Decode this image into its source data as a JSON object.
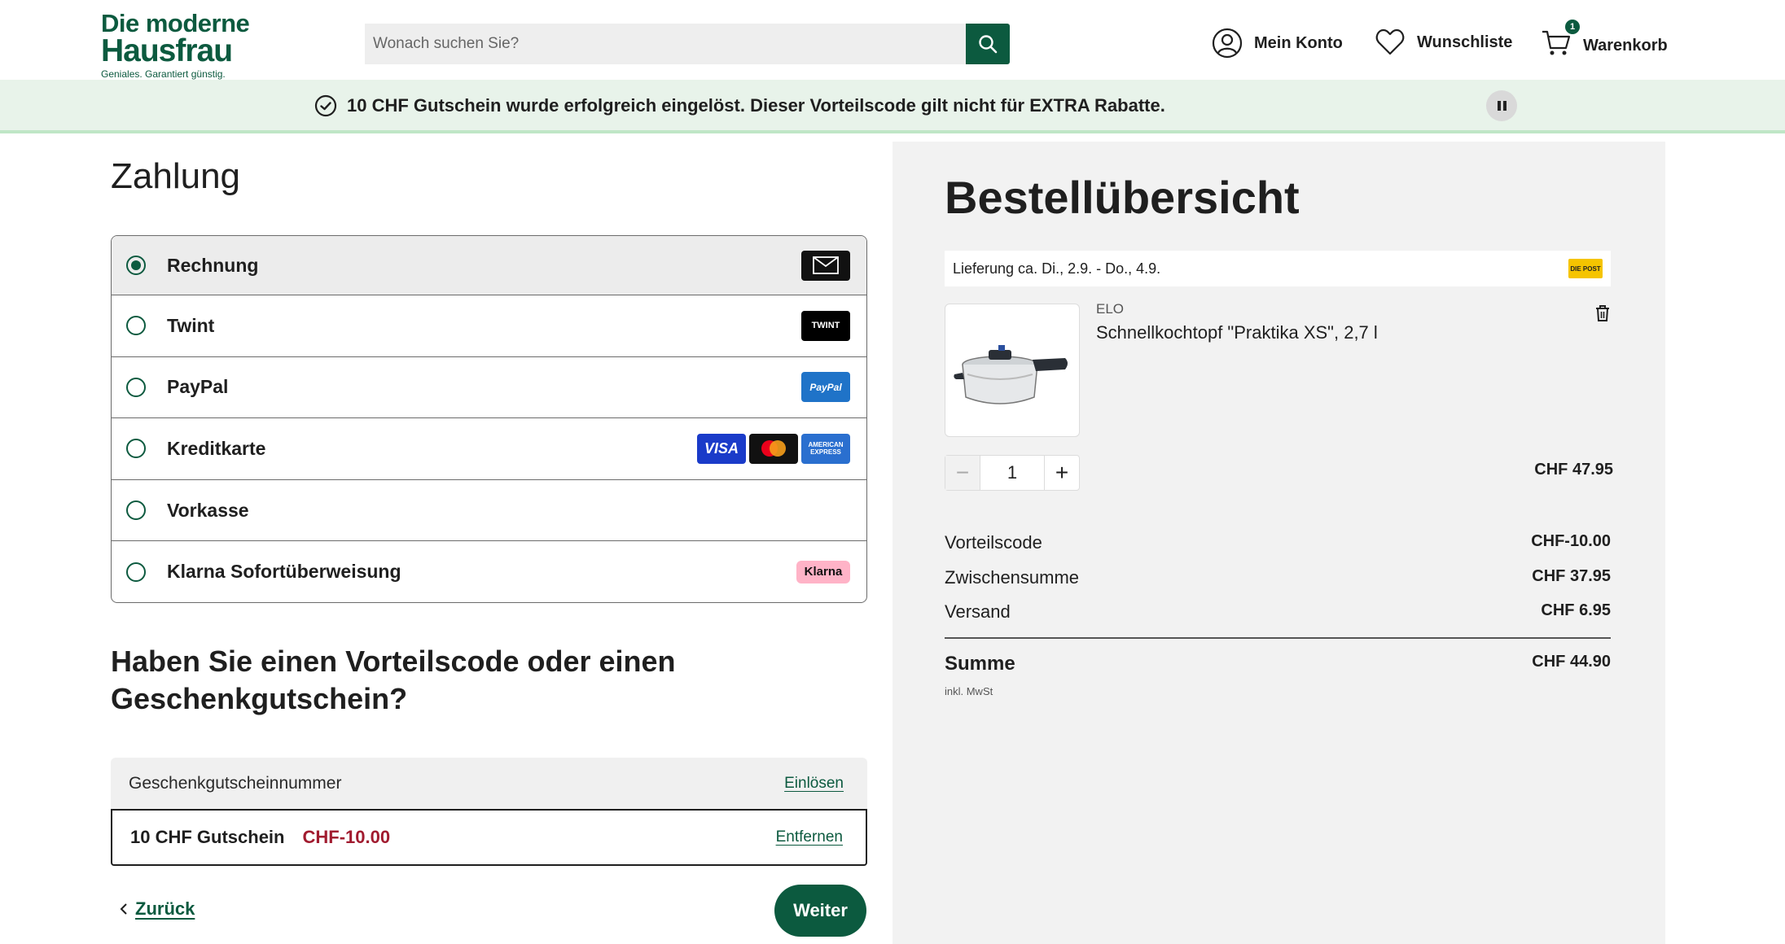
{
  "header": {
    "logo_line1": "Die moderne",
    "logo_line2": "Hausfrau",
    "logo_tagline": "Geniales. Garantiert günstig.",
    "search_placeholder": "Wonach suchen Sie?",
    "account_label": "Mein Konto",
    "wishlist_label": "Wunschliste",
    "cart_label": "Warenkorb",
    "cart_count": "1"
  },
  "banner": {
    "message": "10 CHF Gutschein wurde erfolgreich eingelöst. Dieser Vorteilscode gilt nicht für EXTRA Rabatte."
  },
  "payment": {
    "title": "Zahlung",
    "methods": [
      {
        "label": "Rechnung",
        "selected": true,
        "icons": [
          "envelope-icon"
        ]
      },
      {
        "label": "Twint",
        "selected": false,
        "icons": [
          "twint-logo"
        ]
      },
      {
        "label": "PayPal",
        "selected": false,
        "icons": [
          "paypal-logo"
        ]
      },
      {
        "label": "Kreditkarte",
        "selected": false,
        "icons": [
          "visa-logo",
          "mastercard-logo",
          "amex-logo"
        ]
      },
      {
        "label": "Vorkasse",
        "selected": false,
        "icons": []
      },
      {
        "label": "Klarna Sofortüberweisung",
        "selected": false,
        "icons": [
          "klarna-logo"
        ]
      }
    ],
    "logo_texts": {
      "twint": "TWINT",
      "paypal": "PayPal",
      "visa": "VISA",
      "amex": "AMERICAN EXPRESS",
      "klarna": "Klarna"
    }
  },
  "voucher": {
    "title": "Haben Sie einen Vorteilscode oder einen Geschenkgutschein?",
    "input_label": "Geschenkgutscheinnummer",
    "redeem_label": "Einlösen",
    "applied_name": "10 CHF Gutschein",
    "applied_amount": "CHF-10.00",
    "remove_label": "Entfernen"
  },
  "nav": {
    "back_label": "Zurück",
    "next_label": "Weiter"
  },
  "summary": {
    "title": "Bestellübersicht",
    "delivery": "Lieferung ca. Di., 2.9. - Do., 4.9.",
    "delivery_carrier": "DIE POST",
    "product": {
      "brand": "ELO",
      "name": "Schnellkochtopf \"Praktika XS\", 2,7 l",
      "quantity": "1",
      "price": "CHF 47.95"
    },
    "lines": [
      {
        "label": "Vorteilscode",
        "value": "CHF-10.00"
      },
      {
        "label": "Zwischensumme",
        "value": "CHF 37.95"
      },
      {
        "label": "Versand",
        "value": "CHF 6.95"
      }
    ],
    "total_label": "Summe",
    "total_value": "CHF 44.90",
    "vat_note": "inkl. MwSt"
  },
  "colors": {
    "brand_green": "#0c5a3f",
    "discount_red": "#a11b2f",
    "banner_bg": "#e8f3ea"
  }
}
